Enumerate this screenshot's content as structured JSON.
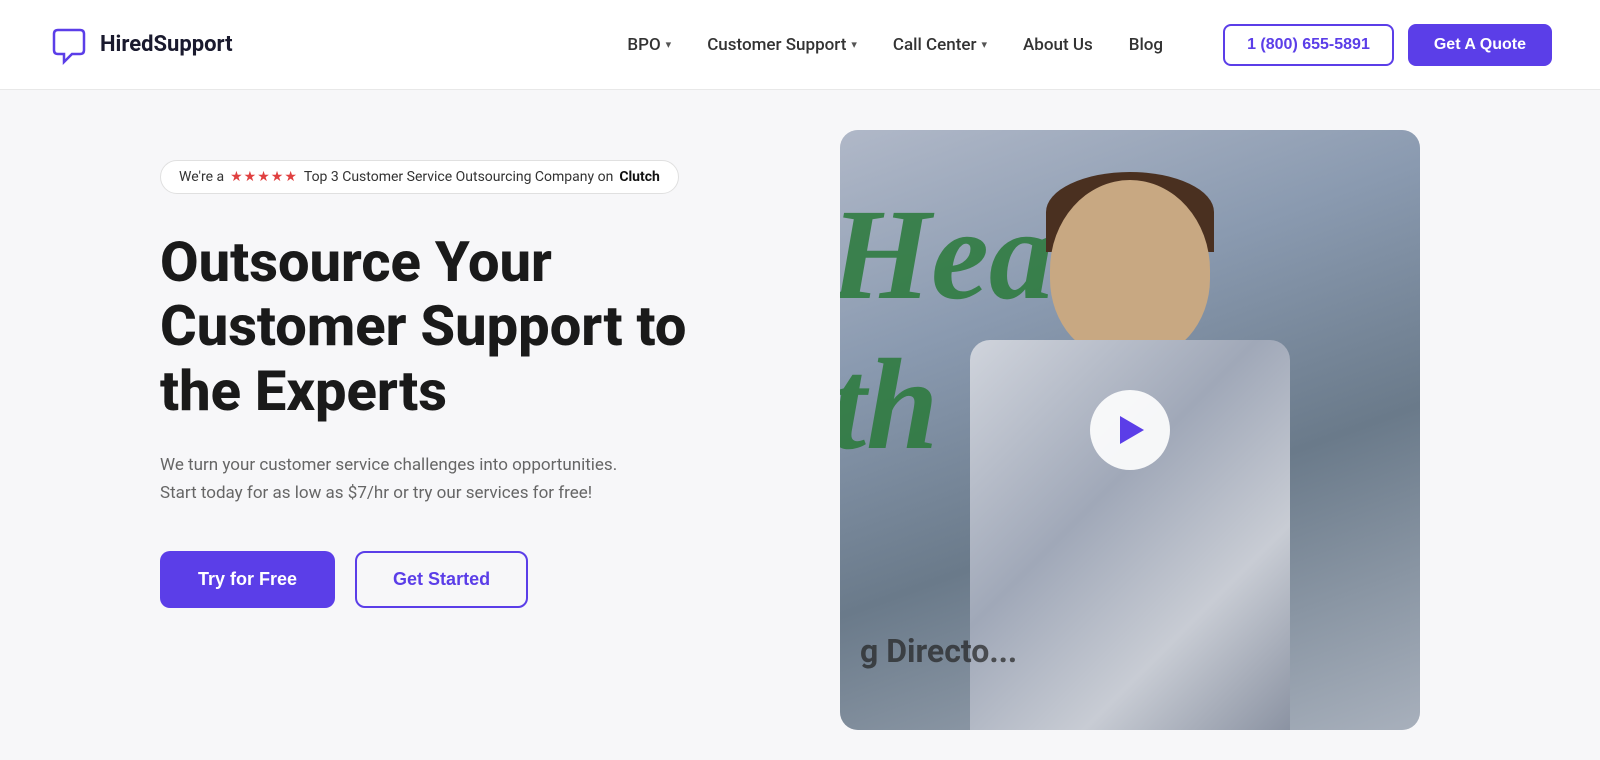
{
  "brand": {
    "name": "HiredSupport",
    "logo_icon": "chat-icon"
  },
  "navbar": {
    "links": [
      {
        "label": "BPO",
        "has_dropdown": true
      },
      {
        "label": "Customer Support",
        "has_dropdown": true
      },
      {
        "label": "Call Center",
        "has_dropdown": true
      },
      {
        "label": "About Us",
        "has_dropdown": false
      },
      {
        "label": "Blog",
        "has_dropdown": false
      }
    ],
    "phone": "1 (800) 655-5891",
    "quote_label": "Get A Quote"
  },
  "hero": {
    "badge_text": "We're a",
    "badge_stars": "★★★★★",
    "badge_suffix": "Top 3 Customer Service Outsourcing Company on",
    "badge_brand": "Clutch",
    "title_line1": "Outsource Your",
    "title_line2": "Customer Support to",
    "title_line3": "the Experts",
    "description": "We turn your customer service challenges into opportunities. Start today for as low as $7/hr or try our services for free!",
    "try_button": "Try for Free",
    "started_button": "Get Started"
  },
  "video": {
    "play_label": "Play video",
    "caption": "g Directo..."
  }
}
